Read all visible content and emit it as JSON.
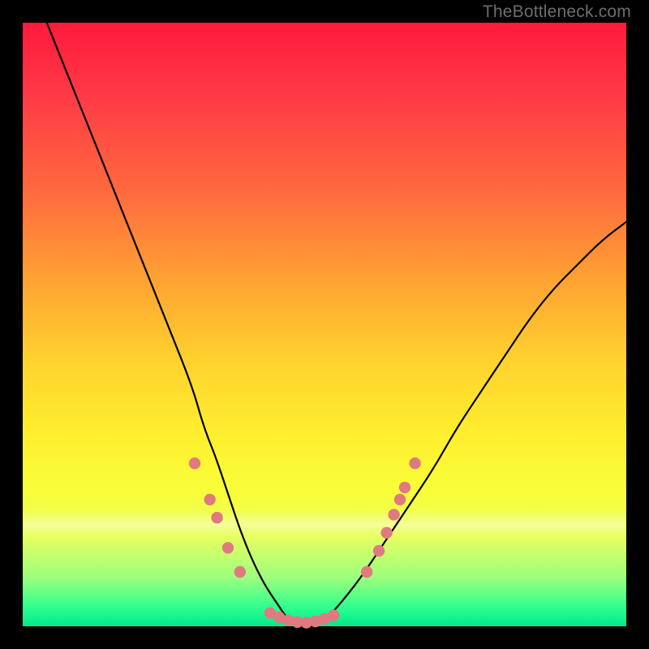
{
  "watermark": "TheBottleneck.com",
  "chart_data": {
    "type": "line",
    "title": "",
    "xlabel": "",
    "ylabel": "",
    "xlim": [
      0,
      100
    ],
    "ylim": [
      0,
      100
    ],
    "background_gradient": {
      "top_color": "#ff1a3c",
      "mid_color": "#ffd22e",
      "bottom_color": "#00e88c",
      "meaning": "bottleneck severity, red≈high, green≈low"
    },
    "series": [
      {
        "name": "bottleneck-curve",
        "description": "V-shaped bottleneck curve; y≈100 means severe bottleneck, y≈0 means balanced",
        "x": [
          0,
          4,
          8,
          12,
          16,
          20,
          24,
          28,
          30,
          32,
          34,
          36,
          38,
          40,
          42,
          44,
          46,
          48,
          50,
          52,
          56,
          60,
          64,
          68,
          72,
          76,
          80,
          84,
          88,
          92,
          96,
          100
        ],
        "y": [
          110,
          100,
          90,
          80,
          70,
          60,
          50,
          40,
          33,
          28,
          22,
          16,
          11,
          7,
          4,
          1,
          0,
          0,
          1,
          3,
          8,
          14,
          20,
          26,
          33,
          39,
          45,
          51,
          56,
          60,
          64,
          67
        ]
      }
    ],
    "markers": {
      "name": "highlighted-points",
      "color": "#e07a80",
      "points": [
        {
          "x": 28.5,
          "y": 27
        },
        {
          "x": 31.0,
          "y": 21
        },
        {
          "x": 32.2,
          "y": 18
        },
        {
          "x": 34.0,
          "y": 13
        },
        {
          "x": 36.0,
          "y": 9
        },
        {
          "x": 41.0,
          "y": 2.2
        },
        {
          "x": 42.5,
          "y": 1.5
        },
        {
          "x": 44.0,
          "y": 1.0
        },
        {
          "x": 45.5,
          "y": 0.7
        },
        {
          "x": 47.0,
          "y": 0.6
        },
        {
          "x": 48.5,
          "y": 0.8
        },
        {
          "x": 50.0,
          "y": 1.2
        },
        {
          "x": 51.5,
          "y": 1.8
        },
        {
          "x": 57.0,
          "y": 9.0
        },
        {
          "x": 59.0,
          "y": 12.5
        },
        {
          "x": 60.3,
          "y": 15.5
        },
        {
          "x": 61.5,
          "y": 18.5
        },
        {
          "x": 62.5,
          "y": 21.0
        },
        {
          "x": 63.3,
          "y": 23.0
        },
        {
          "x": 65.0,
          "y": 27.0
        }
      ]
    }
  }
}
